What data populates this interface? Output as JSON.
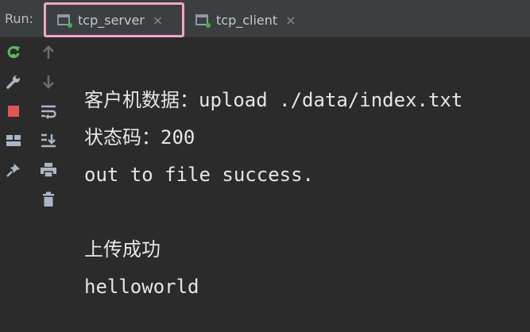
{
  "run_label": "Run:",
  "tabs": [
    {
      "title": "tcp_server",
      "close": "×",
      "active": true
    },
    {
      "title": "tcp_client",
      "close": "×",
      "active": false
    }
  ],
  "toolbar": {
    "left_column": [
      "rerun-icon",
      "wrench-icon",
      "stop-icon",
      "layout-icon",
      "pin-icon"
    ],
    "right_column": [
      "arrow-up-icon",
      "arrow-down-icon",
      "soft-wrap-icon",
      "scroll-to-end-icon",
      "print-icon",
      "trash-icon"
    ]
  },
  "console": {
    "lines": [
      "客户机数据：upload ./data/index.txt",
      "状态码：200",
      "out to file success.",
      "",
      "上传成功",
      "helloworld"
    ]
  },
  "colors": {
    "background": "#2b2b2b",
    "tabbar": "#3c3f41",
    "active_tab_border": "#f3a4c8",
    "text": "#e6e6e6",
    "rerun": "#5fb85f",
    "stop": "#e05555",
    "running_dot": "#43b24c"
  }
}
